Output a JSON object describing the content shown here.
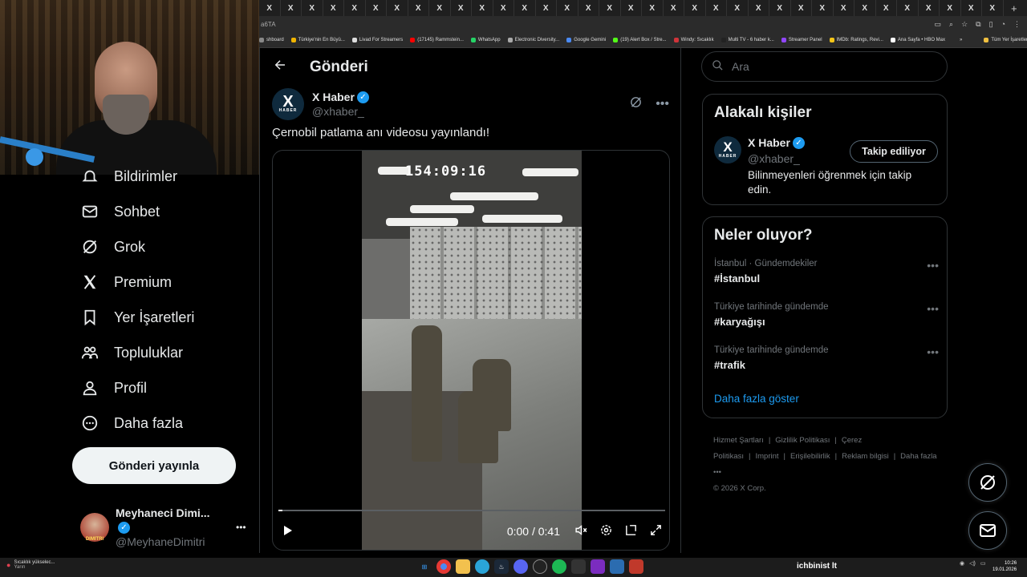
{
  "browser": {
    "tab_glyph": "X",
    "new_tab": "+",
    "address_fragment": "a6TA",
    "bookmarks": [
      {
        "label": "shboard",
        "color": "#888"
      },
      {
        "label": "Türkiye'nin En Büyü...",
        "color": "#f0b400"
      },
      {
        "label": "Livad For Streamers",
        "color": "#ddd"
      },
      {
        "label": "(17145) Rammstein...",
        "color": "#ff0000"
      },
      {
        "label": "WhatsApp",
        "color": "#25d366"
      },
      {
        "label": "Electronic Diversity...",
        "color": "#aaa"
      },
      {
        "label": "Google Gemini",
        "color": "#4a8af4"
      },
      {
        "label": "(19) Alert Box / Stre...",
        "color": "#53fc18"
      },
      {
        "label": "Windy: Sıcaklık",
        "color": "#d0343a"
      },
      {
        "label": "Multi TV - 6 haber k...",
        "color": "#222"
      },
      {
        "label": "Streamer Panel",
        "color": "#9146ff"
      },
      {
        "label": "IMDb: Ratings, Revi...",
        "color": "#f5c518"
      },
      {
        "label": "Ana Sayfa • HBO Max",
        "color": "#fff"
      },
      {
        "label": "»",
        "color": "transparent"
      },
      {
        "label": "Tüm Yer İşaretleri",
        "color": "#f0c040"
      }
    ]
  },
  "nav": {
    "items": [
      {
        "label": "Bildirimler",
        "icon": "bell-icon"
      },
      {
        "label": "Sohbet",
        "icon": "mail-icon"
      },
      {
        "label": "Grok",
        "icon": "grok-icon"
      },
      {
        "label": "Premium",
        "icon": "x-icon"
      },
      {
        "label": "Yer İşaretleri",
        "icon": "bookmark-icon"
      },
      {
        "label": "Topluluklar",
        "icon": "people-icon"
      },
      {
        "label": "Profil",
        "icon": "person-icon"
      },
      {
        "label": "Daha fazla",
        "icon": "more-circle-icon"
      }
    ],
    "post_button": "Gönderi yayınla",
    "user": {
      "name": "Meyhaneci Dimi...",
      "handle": "@MeyhaneDimitri",
      "avatar_text": "DIMITRI",
      "more": "•••"
    }
  },
  "main": {
    "header_title": "Gönderi",
    "author": {
      "logo_text": "X",
      "logo_sub": "HABER",
      "name": "X Haber",
      "handle": "@xhaber_"
    },
    "tweet_text": "Çernobil patlama anı videosu yayınlandı!",
    "video": {
      "timestamp_overlay": "154:09:16",
      "time": "0:00 / 0:41",
      "progress": 0.01
    }
  },
  "sidebar": {
    "search_placeholder": "Ara",
    "related": {
      "title": "Alakalı kişiler",
      "name": "X Haber",
      "handle": "@xhaber_",
      "follow_button": "Takip ediliyor",
      "bio": "Bilinmeyenleri öğrenmek için takip edin."
    },
    "trends": {
      "title": "Neler oluyor?",
      "items": [
        {
          "meta": "İstanbul · Gündemdekiler",
          "tag": "#İstanbul"
        },
        {
          "meta": "Türkiye tarihinde gündemde",
          "tag": "#karyağışı"
        },
        {
          "meta": "Türkiye tarihinde gündemde",
          "tag": "#trafik"
        }
      ],
      "show_more": "Daha fazla göster"
    },
    "footer": {
      "links": [
        "Hizmet Şartları",
        "|",
        "Gizlilik Politikası",
        "|",
        "Çerez Politikası",
        "|",
        "Imprint",
        "|",
        "Erişilebilirlik",
        "|",
        "Reklam bilgisi",
        "|",
        "Daha fazla •••"
      ],
      "copyright": "© 2026 X Corp."
    }
  },
  "taskbar": {
    "weather_line1": "Sıcaklık yükselec...",
    "weather_line2": "Yarın",
    "center_text": "ichbinist  lt",
    "time": "10:26",
    "date": "19.01.2026"
  }
}
